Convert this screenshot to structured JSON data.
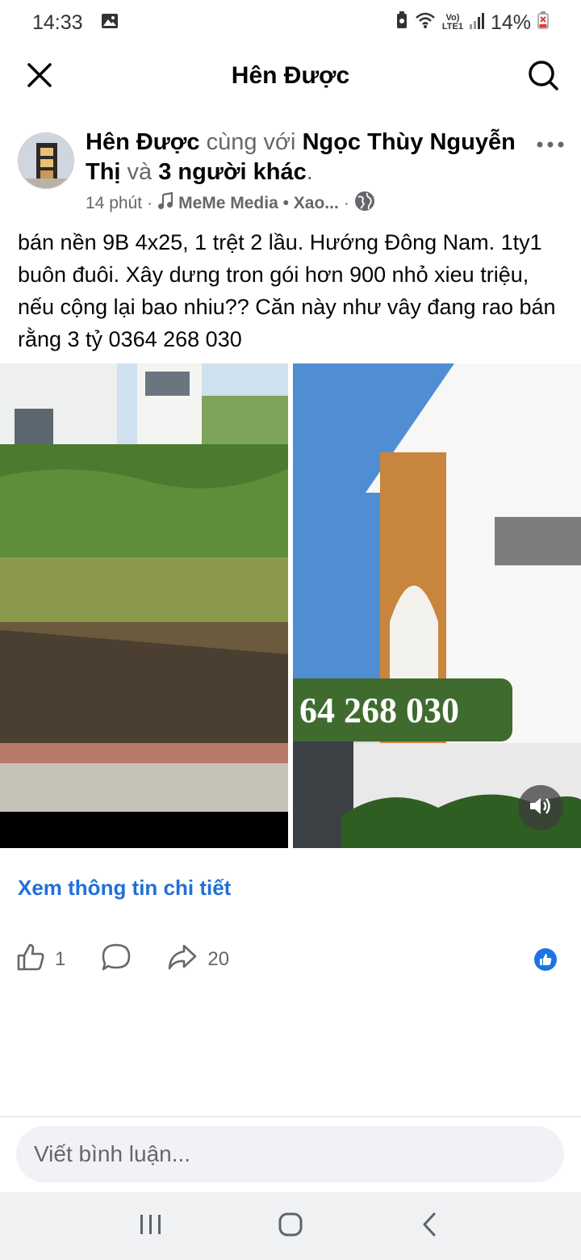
{
  "status_bar": {
    "time": "14:33",
    "battery": "14%",
    "net_label": "Vo)\nLTE1"
  },
  "header": {
    "title": "Hên Được"
  },
  "post": {
    "author": "Hên Được",
    "with_word": " cùng với ",
    "tagged": "Ngọc Thùy Nguyễn Thị",
    "and_word": " và ",
    "others": "3 người khác",
    "period": ".",
    "time": "14 phút",
    "music": "MeMe Media • Xao...",
    "dot": "·",
    "text": "bán nền 9B 4x25, 1 trệt 2 lầu. Hướng Đông Nam. 1ty1 buôn đuôi.  Xây dưng tron gói hơn 900 nhỏ xieu triệu,  nếu cộng lại bao nhiu?? Căn này như vây đang rao bán rằng 3 tỷ 0364 268 030",
    "image_overlay_phone": "64 268 030",
    "cta": "Xem thông tin chi tiết"
  },
  "actions": {
    "likes": "1",
    "shares": "20"
  },
  "comment": {
    "placeholder": "Viết bình luận..."
  },
  "colors": {
    "accent": "#1b74e4",
    "link": "#216fdb",
    "badge_green": "#3f6b2e"
  },
  "icons": [
    "image-icon",
    "battery-saver-icon",
    "wifi-icon",
    "signal-icon",
    "battery-icon",
    "close-icon",
    "search-icon",
    "more-icon",
    "music-icon",
    "globe-icon",
    "volume-icon",
    "like-icon",
    "comment-icon",
    "share-icon",
    "like-badge-icon",
    "recent-apps-icon",
    "home-icon",
    "back-icon"
  ]
}
